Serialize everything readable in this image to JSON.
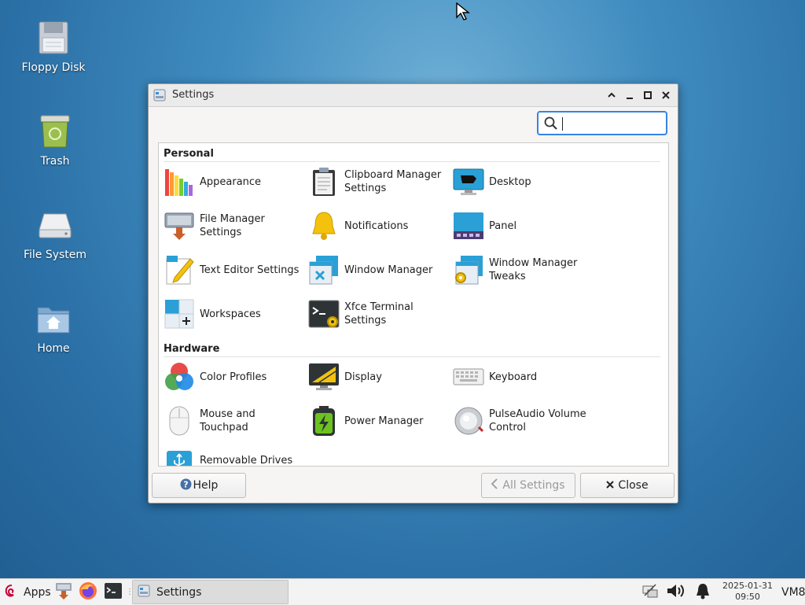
{
  "desktop": {
    "icons": [
      {
        "label": "Floppy Disk"
      },
      {
        "label": "Trash"
      },
      {
        "label": "File System"
      },
      {
        "label": "Home"
      }
    ]
  },
  "window": {
    "title": "Settings",
    "search": {
      "value": "",
      "placeholder": ""
    },
    "sections": [
      {
        "title": "Personal",
        "items": [
          {
            "label": "Appearance",
            "icon": "appearance-icon"
          },
          {
            "label": "Clipboard Manager Settings",
            "icon": "clipboard-icon"
          },
          {
            "label": "Desktop",
            "icon": "desktop-icon"
          },
          {
            "label": "File Manager Settings",
            "icon": "file-manager-icon"
          },
          {
            "label": "Notifications",
            "icon": "bell-icon"
          },
          {
            "label": "Panel",
            "icon": "panel-icon"
          },
          {
            "label": "Text Editor Settings",
            "icon": "text-editor-icon"
          },
          {
            "label": "Window Manager",
            "icon": "window-manager-icon"
          },
          {
            "label": "Window Manager Tweaks",
            "icon": "window-tweaks-icon"
          },
          {
            "label": "Workspaces",
            "icon": "workspaces-icon"
          },
          {
            "label": "Xfce Terminal Settings",
            "icon": "terminal-settings-icon"
          }
        ]
      },
      {
        "title": "Hardware",
        "items": [
          {
            "label": "Color Profiles",
            "icon": "color-profiles-icon"
          },
          {
            "label": "Display",
            "icon": "display-icon"
          },
          {
            "label": "Keyboard",
            "icon": "keyboard-icon"
          },
          {
            "label": "Mouse and Touchpad",
            "icon": "mouse-icon"
          },
          {
            "label": "Power Manager",
            "icon": "battery-icon"
          },
          {
            "label": "PulseAudio Volume Control",
            "icon": "speaker-icon"
          },
          {
            "label": "Removable Drives",
            "icon": "usb-icon"
          }
        ]
      }
    ],
    "buttons": {
      "help": "Help",
      "all_settings": "All Settings",
      "close": "Close"
    }
  },
  "taskbar": {
    "apps_label": "Apps",
    "window_button": "Settings",
    "clock_date": "2025-01-31",
    "clock_time": "09:50",
    "hostname": "VM8"
  },
  "colors": {
    "accent": "#3584e4",
    "desktop": "#2f78b0"
  }
}
